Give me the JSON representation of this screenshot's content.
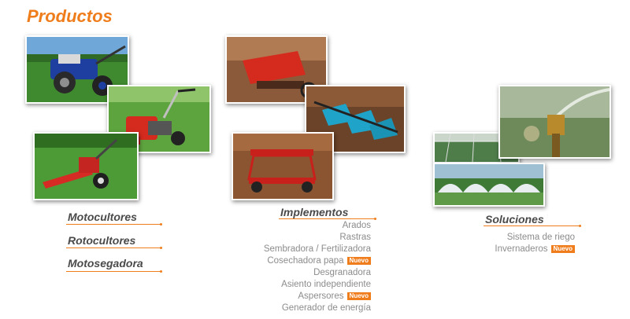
{
  "page": {
    "title": "Productos"
  },
  "colors": {
    "accent": "#f07d1c",
    "heading": "#4a4a4a",
    "sublink": "#8c8c8c"
  },
  "groups": [
    {
      "categories": [
        {
          "label": "Motocultores"
        },
        {
          "label": "Rotocultores"
        },
        {
          "label": "Motosegadora"
        }
      ]
    },
    {
      "categories": [
        {
          "label": "Implementos"
        }
      ],
      "items": [
        {
          "label": "Arados",
          "badge": ""
        },
        {
          "label": "Rastras",
          "badge": ""
        },
        {
          "label": "Sembradora / Fertilizadora",
          "badge": ""
        },
        {
          "label": "Cosechadora papa",
          "badge": "Nuevo"
        },
        {
          "label": "Desgranadora",
          "badge": ""
        },
        {
          "label": "Asiento independiente",
          "badge": ""
        },
        {
          "label": "Aspersores",
          "badge": "Nuevo"
        },
        {
          "label": "Generador de energía",
          "badge": ""
        }
      ]
    },
    {
      "categories": [
        {
          "label": "Soluciones"
        }
      ],
      "items": [
        {
          "label": "Sistema de riego",
          "badge": ""
        },
        {
          "label": "Invernaderos",
          "badge": "Nuevo"
        }
      ]
    }
  ]
}
